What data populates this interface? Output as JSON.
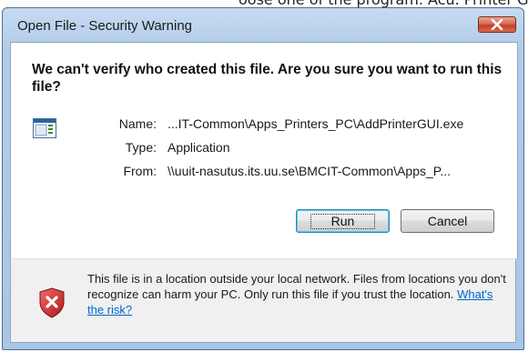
{
  "background_text": "oose one of the program. Acu. Printer GUI",
  "window": {
    "title": "Open File - Security Warning"
  },
  "headline": "We can't verify who created this file. Are you sure you want to run this file?",
  "fields": [
    {
      "label": "Name:",
      "value": "...IT-Common\\Apps_Printers_PC\\AddPrinterGUI.exe"
    },
    {
      "label": "Type:",
      "value": "Application"
    },
    {
      "label": "From:",
      "value": "\\\\uuit-nasutus.its.uu.se\\BMCIT-Common\\Apps_P..."
    }
  ],
  "buttons": {
    "run": "Run",
    "cancel": "Cancel"
  },
  "footer": {
    "message": "This file is in a location outside your local network. Files from locations you don't recognize can harm your PC. Only run this file if you trust the location.",
    "link": "What's the risk?"
  },
  "colors": {
    "title_bar": "#b3cde9",
    "close_button": "#c1412a",
    "link": "#0066cc",
    "shield": "#cc2020"
  }
}
